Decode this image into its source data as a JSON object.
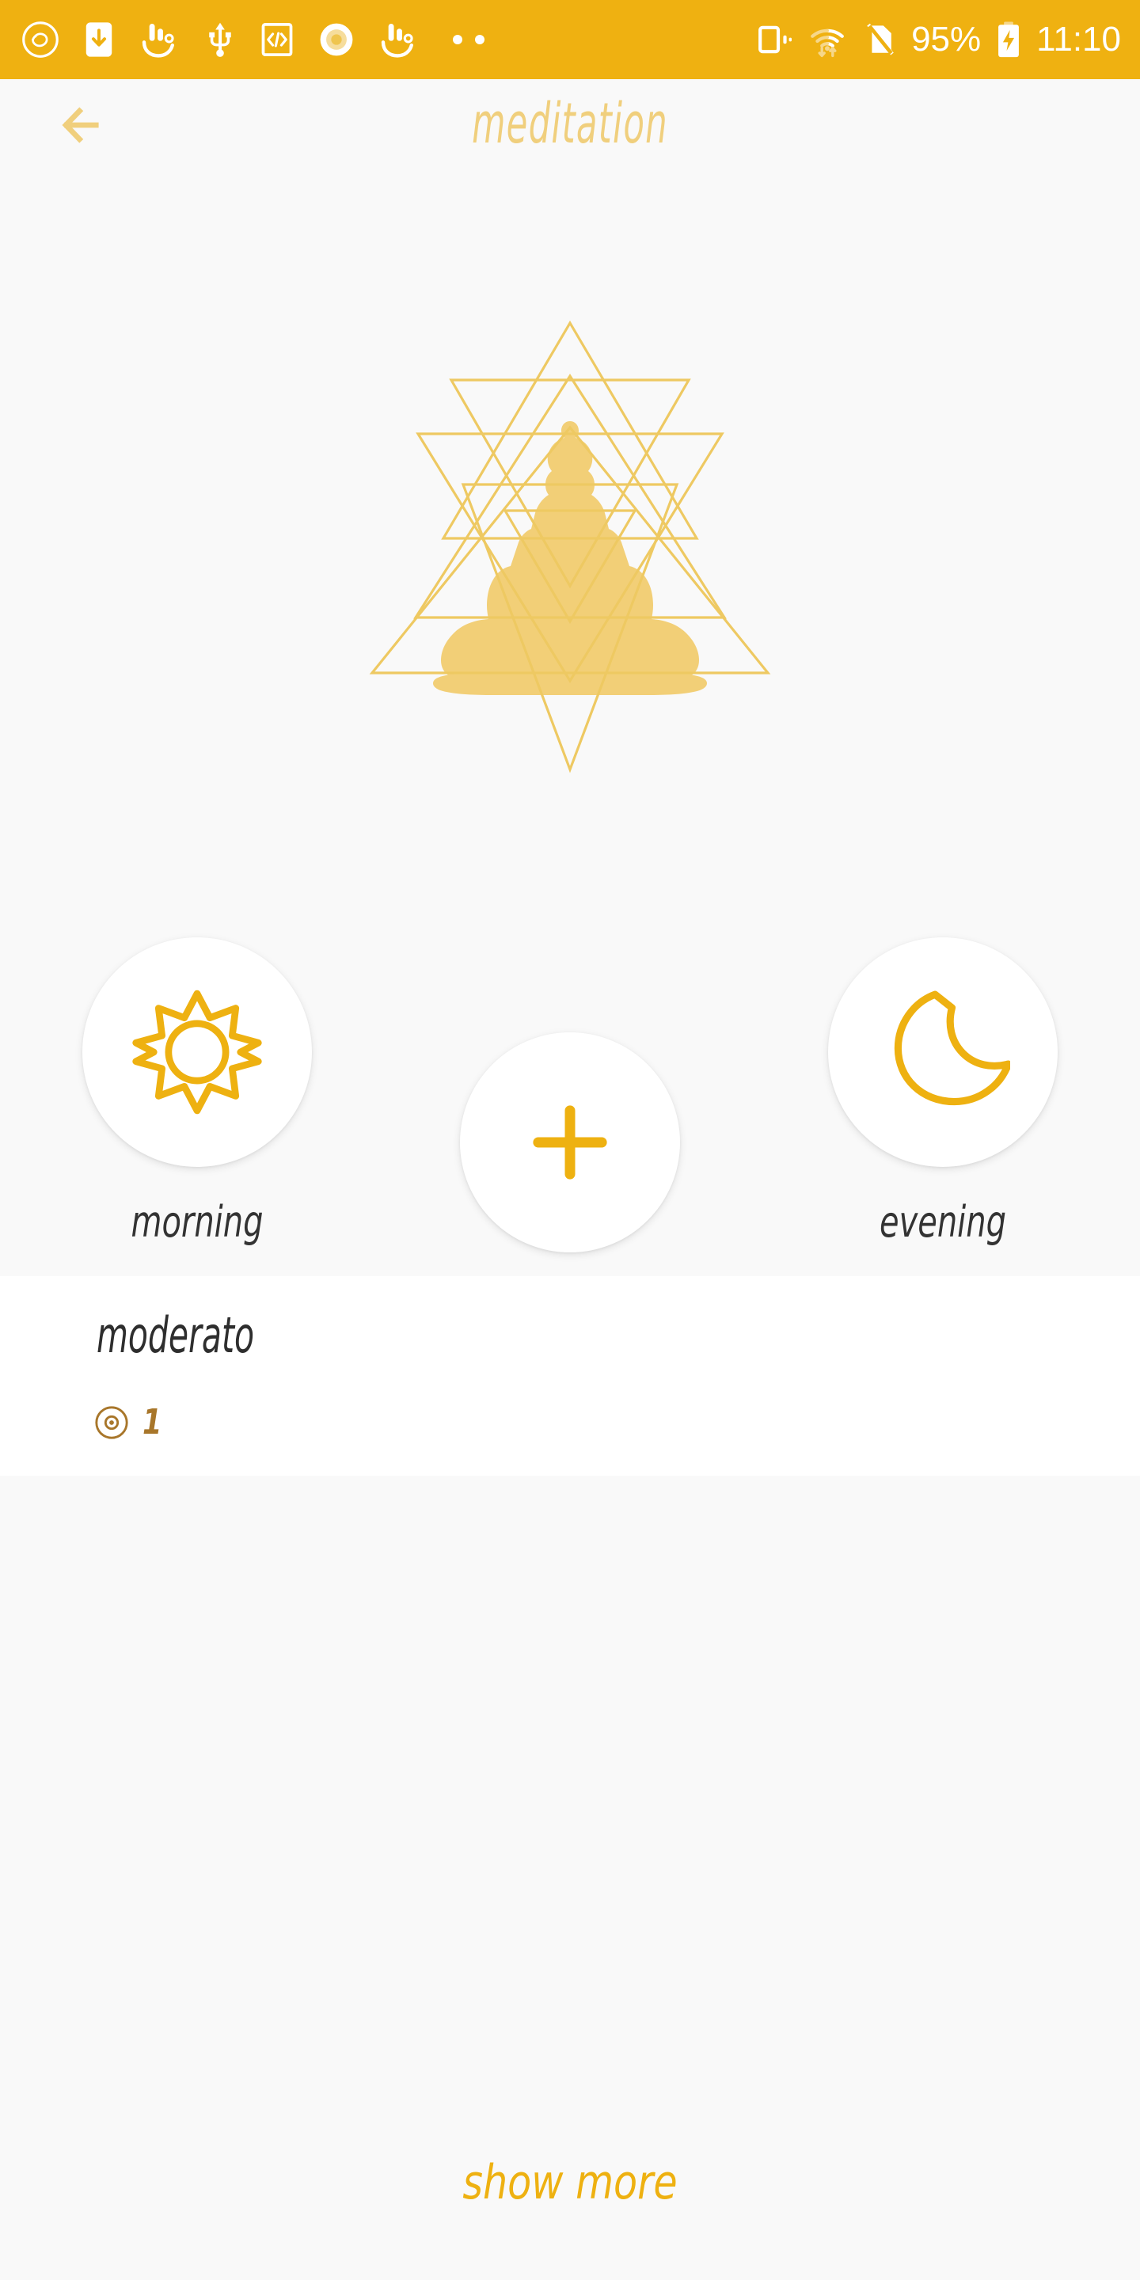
{
  "status_bar": {
    "background": "#efb111",
    "battery_percent": "95%",
    "time": "11:10",
    "left_icons": [
      "app-logo-icon",
      "screenshot-download-icon",
      "touchpal-keyboard-icon",
      "usb-icon",
      "developer-code-icon",
      "app-circle-icon",
      "touchpal-keyboard-icon-2",
      "more-notifications-icon"
    ],
    "right_icons": [
      "vibrate-icon",
      "wifi-icon",
      "no-sim-icon",
      "battery-charging-icon"
    ]
  },
  "app_bar": {
    "back_icon": "arrow-left-icon",
    "title": "meditation",
    "title_color": "#f0cf7d"
  },
  "hero": {
    "mandala": {
      "name": "sri-yantra-buddha-illustration",
      "line_color": "#eec962",
      "buddha_color": "#f2cf77"
    },
    "actions": [
      {
        "key": "morning",
        "label": "morning",
        "icon": "sun-icon",
        "icon_color": "#eeb111"
      },
      {
        "key": "create",
        "label": "create",
        "icon": "plus-icon",
        "icon_color": "#eeb111"
      },
      {
        "key": "evening",
        "label": "evening",
        "icon": "moon-icon",
        "icon_color": "#eeb111"
      }
    ]
  },
  "list": {
    "items": [
      {
        "title": "moderato",
        "count": "1",
        "count_icon": "disc-icon",
        "count_color": "#a8762a"
      }
    ]
  },
  "footer": {
    "show_more_label": "show more",
    "show_more_color": "#eeb111"
  }
}
